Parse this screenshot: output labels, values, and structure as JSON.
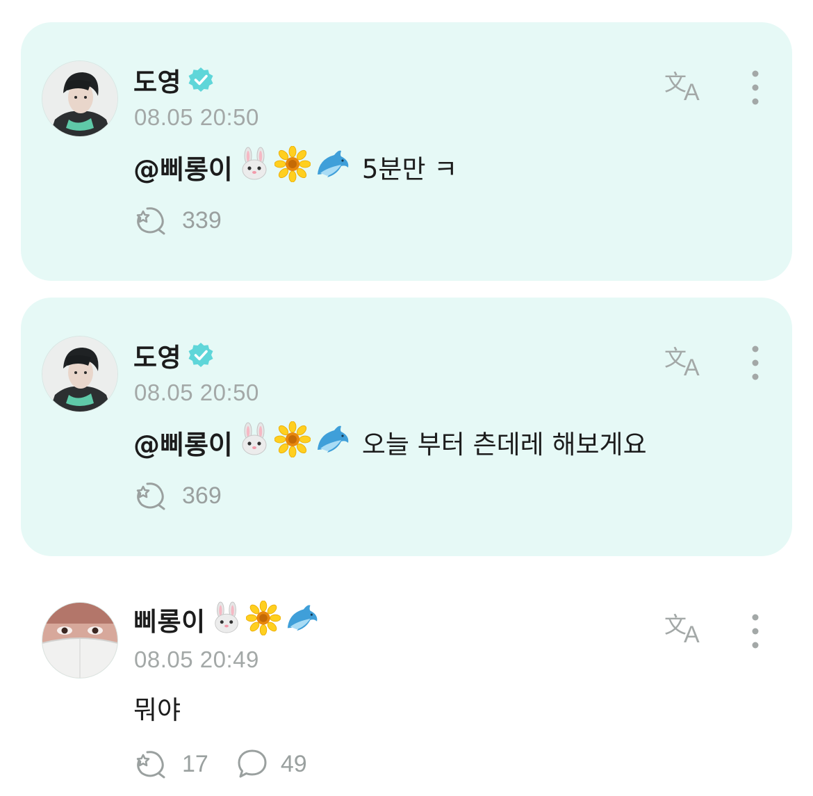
{
  "posts": [
    {
      "author": "도영",
      "verified": true,
      "timestamp": "08.05 20:50",
      "mention": "@삐롱이",
      "mention_emojis": [
        "rabbit-face",
        "sunflower",
        "dolphin"
      ],
      "text": "5분만 ㅋ",
      "likes": "339",
      "highlighted": true
    },
    {
      "author": "도영",
      "verified": true,
      "timestamp": "08.05 20:50",
      "mention": "@삐롱이",
      "mention_emojis": [
        "rabbit-face",
        "sunflower",
        "dolphin"
      ],
      "text": "오늘 부터 츤데레 해보게요",
      "likes": "369",
      "highlighted": true
    },
    {
      "author": "삐롱이",
      "author_emojis": [
        "rabbit-face",
        "sunflower",
        "dolphin"
      ],
      "verified": false,
      "timestamp": "08.05 20:49",
      "text": "뭐야",
      "likes": "17",
      "comments": "49",
      "highlighted": false
    }
  ],
  "colors": {
    "card_background": "#e6f9f6",
    "verified_badge": "#5fd6d9",
    "muted_text": "#a3a8a7",
    "icon_gray": "#9aa09f"
  },
  "icons": {
    "translate": "translate-icon",
    "more": "more-vertical-icon",
    "like": "like-icon",
    "comment": "comment-icon",
    "verified": "verified-badge-icon"
  }
}
